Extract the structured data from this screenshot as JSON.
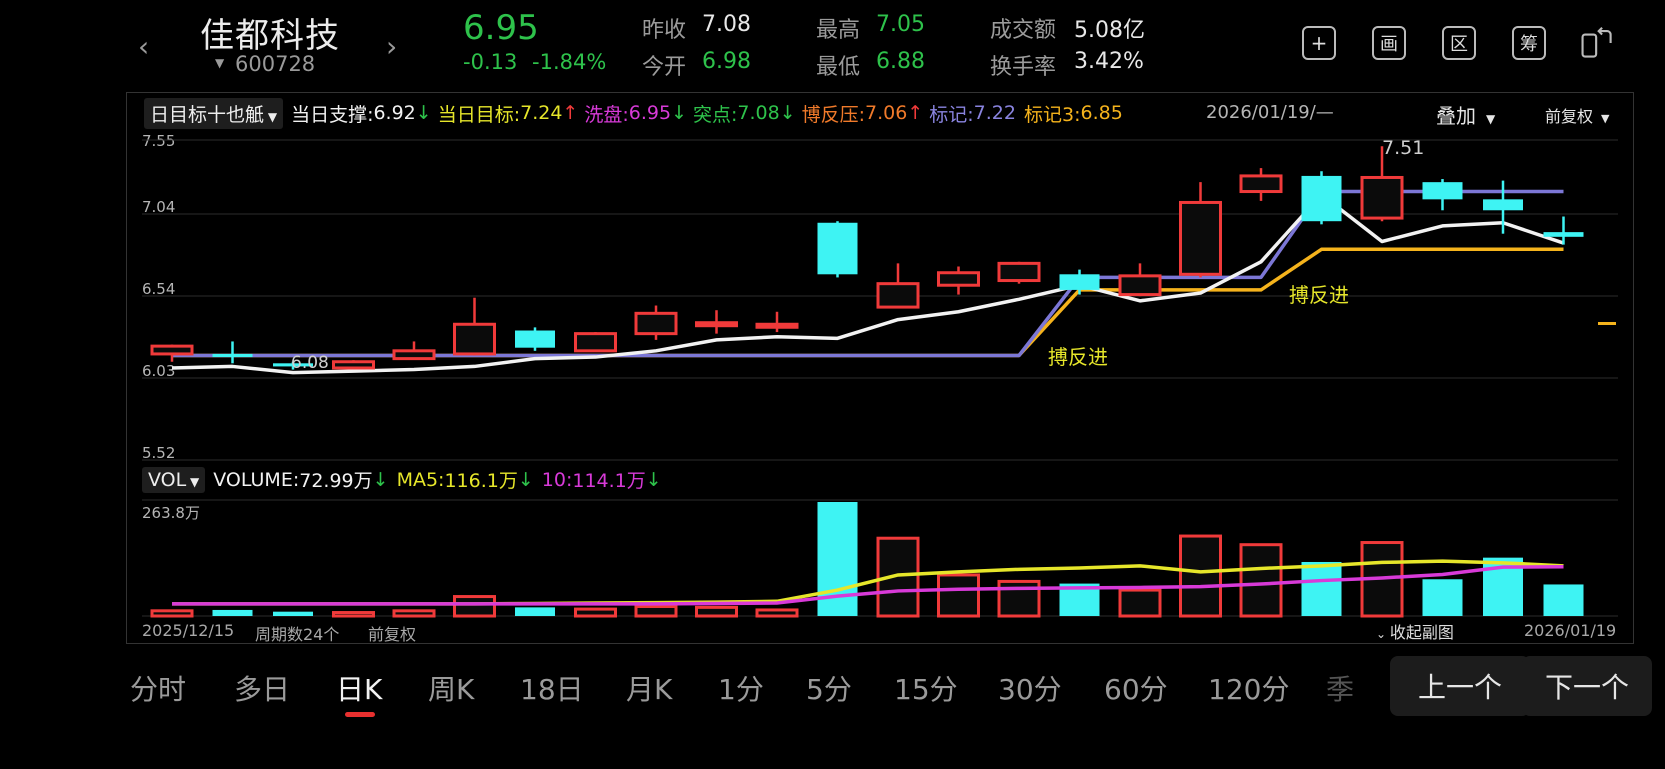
{
  "header": {
    "prev_arrow": "‹",
    "next_arrow": "›",
    "name": "佳都科技",
    "code": "600728",
    "price": "6.95",
    "change": "-0.13",
    "change_pct": "-1.84%",
    "quotes": {
      "prev_close_label": "昨收",
      "prev_close": "7.08",
      "open_label": "今开",
      "open": "6.98",
      "high_label": "最高",
      "high": "7.05",
      "low_label": "最低",
      "low": "6.88",
      "turnover_label": "成交额",
      "turnover": "5.08亿",
      "turnover_rate_label": "换手率",
      "turnover_rate": "3.42%"
    },
    "toolbar": {
      "add_icon": "plus-square-icon",
      "draw_glyph": "画",
      "range_glyph": "区",
      "chips_glyph": "筹",
      "rotate_icon": "rotate-screen-icon"
    }
  },
  "indicator_bar": {
    "selector": "日目标十也觗",
    "support_label": "当日支撑:",
    "support": "6.92",
    "target_label": "当日目标:",
    "target": "7.24",
    "wash_label": "洗盘:",
    "wash": "6.95",
    "breakout_label": "突点:",
    "breakout": "7.08",
    "pressure_label": "博反压:",
    "pressure": "7.06",
    "mark_label": "标记:",
    "mark": "7.22",
    "mark3_label": "标记3:",
    "mark3": "6.85",
    "date": "2026/01/19/—",
    "overlay": "叠加",
    "adjust": "前复权"
  },
  "price_axis": [
    "7.55",
    "7.04",
    "6.54",
    "6.03",
    "5.52"
  ],
  "vol_bar": {
    "selector": "VOL",
    "volume_label": "VOLUME:",
    "volume": "72.99万",
    "ma5_label": "MA5:",
    "ma5": "116.1万",
    "ma10_label": "10:",
    "ma10": "114.1万",
    "vol_max": "263.8万"
  },
  "footer": {
    "start_date": "2025/12/15",
    "period_count": "周期数24个",
    "adjust": "前复权",
    "collapse": "收起副图",
    "end_date": "2026/01/19"
  },
  "annotations": {
    "high_mark": "7.51",
    "low_mark": "6.08",
    "signal_1": "搏反进",
    "signal_2": "搏反进"
  },
  "tabs": [
    "分时",
    "多日",
    "日K",
    "周K",
    "18日",
    "月K",
    "1分",
    "5分",
    "15分",
    "30分",
    "60分",
    "120分",
    "季"
  ],
  "nav": {
    "prev": "上一个",
    "next": "下一个"
  },
  "colors": {
    "up": "#f03a3a",
    "down": "#3ef3f3",
    "ma_white": "#f2f2f2",
    "support_line": "#f5b31c",
    "mark_line": "#7c77d6",
    "vol_ma5": "#e6e62a",
    "vol_ma10": "#d83ad8",
    "pos": "#2ec24b",
    "neg": "#f03a3a"
  },
  "chart_data": {
    "type": "candlestick",
    "y_range": [
      5.52,
      7.55
    ],
    "candles": [
      {
        "o": 6.18,
        "c": 6.23,
        "h": 6.24,
        "l": 6.13,
        "v": 12
      },
      {
        "o": 6.18,
        "c": 6.16,
        "h": 6.26,
        "l": 6.12,
        "v": 14
      },
      {
        "o": 6.12,
        "c": 6.1,
        "h": 6.13,
        "l": 6.08,
        "v": 10
      },
      {
        "o": 6.09,
        "c": 6.13,
        "h": 6.14,
        "l": 6.09,
        "v": 8
      },
      {
        "o": 6.15,
        "c": 6.2,
        "h": 6.26,
        "l": 6.15,
        "v": 12
      },
      {
        "o": 6.18,
        "c": 6.37,
        "h": 6.54,
        "l": 6.17,
        "v": 45
      },
      {
        "o": 6.33,
        "c": 6.22,
        "h": 6.35,
        "l": 6.2,
        "v": 20
      },
      {
        "o": 6.2,
        "c": 6.31,
        "h": 6.32,
        "l": 6.2,
        "v": 16
      },
      {
        "o": 6.31,
        "c": 6.44,
        "h": 6.49,
        "l": 6.27,
        "v": 22
      },
      {
        "o": 6.38,
        "c": 6.38,
        "h": 6.46,
        "l": 6.31,
        "v": 20
      },
      {
        "o": 6.37,
        "c": 6.37,
        "h": 6.45,
        "l": 6.32,
        "v": 14
      },
      {
        "o": 7.02,
        "c": 6.69,
        "h": 7.03,
        "l": 6.67,
        "v": 263.8
      },
      {
        "o": 6.48,
        "c": 6.63,
        "h": 6.76,
        "l": 6.48,
        "v": 180
      },
      {
        "o": 6.62,
        "c": 6.7,
        "h": 6.74,
        "l": 6.56,
        "v": 95
      },
      {
        "o": 6.65,
        "c": 6.76,
        "h": 6.77,
        "l": 6.63,
        "v": 80
      },
      {
        "o": 6.69,
        "c": 6.59,
        "h": 6.72,
        "l": 6.56,
        "v": 75
      },
      {
        "o": 6.56,
        "c": 6.68,
        "h": 6.76,
        "l": 6.55,
        "v": 60
      },
      {
        "o": 6.69,
        "c": 7.15,
        "h": 7.28,
        "l": 6.67,
        "v": 185
      },
      {
        "o": 7.22,
        "c": 7.32,
        "h": 7.37,
        "l": 7.16,
        "v": 165
      },
      {
        "o": 7.32,
        "c": 7.03,
        "h": 7.35,
        "l": 7.01,
        "v": 125
      },
      {
        "o": 7.05,
        "c": 7.31,
        "h": 7.51,
        "l": 7.03,
        "v": 170
      },
      {
        "o": 7.28,
        "c": 7.17,
        "h": 7.3,
        "l": 7.1,
        "v": 85
      },
      {
        "o": 7.17,
        "c": 7.1,
        "h": 7.29,
        "l": 6.95,
        "v": 135
      },
      {
        "o": 6.96,
        "c": 6.93,
        "h": 7.06,
        "l": 6.88,
        "v": 72.99
      }
    ],
    "ma_line": [
      6.09,
      6.1,
      6.06,
      6.07,
      6.08,
      6.1,
      6.15,
      6.16,
      6.2,
      6.27,
      6.29,
      6.28,
      6.4,
      6.45,
      6.53,
      6.62,
      6.52,
      6.57,
      6.77,
      7.2,
      6.9,
      7.0,
      7.02,
      6.89
    ],
    "support_line": [
      6.17,
      6.17,
      6.17,
      6.17,
      6.17,
      6.17,
      6.17,
      6.17,
      6.17,
      6.17,
      6.17,
      6.17,
      6.17,
      6.17,
      6.17,
      6.59,
      6.59,
      6.59,
      6.59,
      6.85,
      6.85,
      6.85,
      6.85,
      6.85
    ],
    "mark_line": [
      6.17,
      6.17,
      6.17,
      6.17,
      6.17,
      6.17,
      6.17,
      6.17,
      6.17,
      6.17,
      6.17,
      6.17,
      6.17,
      6.17,
      6.17,
      6.67,
      6.67,
      6.67,
      6.67,
      7.22,
      7.22,
      7.22,
      7.22,
      7.22
    ],
    "vol_ma5": [
      28,
      28,
      28,
      28,
      28,
      28,
      29,
      30,
      31,
      32,
      34,
      60,
      95,
      102,
      108,
      111,
      116,
      102,
      110,
      116,
      124,
      127,
      123,
      116.1
    ],
    "vol_ma10": [
      28,
      28,
      28,
      28,
      28,
      28,
      28,
      28,
      28,
      29,
      30,
      46,
      58,
      62,
      64,
      65,
      66,
      68,
      74,
      82,
      88,
      96,
      113,
      114.1
    ]
  }
}
